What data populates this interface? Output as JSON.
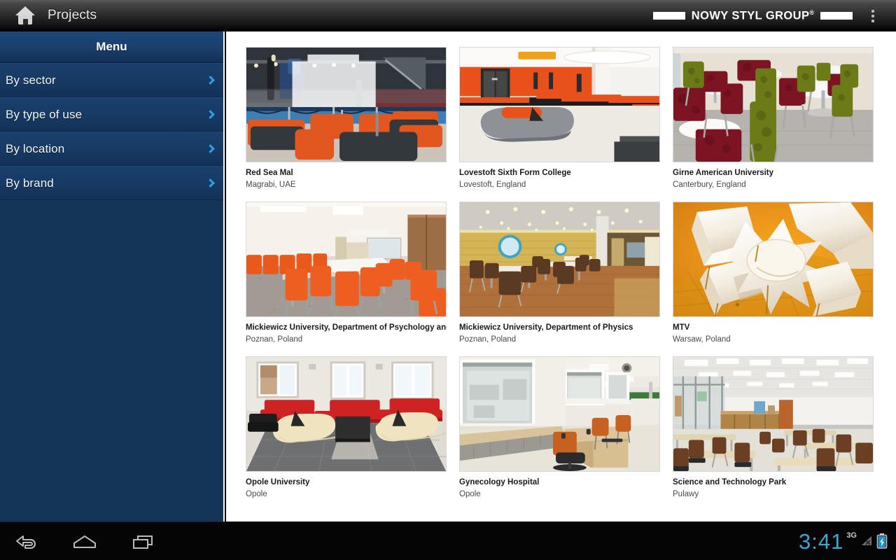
{
  "topbar": {
    "home_icon": "home-icon",
    "title": "Projects",
    "logo_text": "NOWY STYL GROUP",
    "logo_registered": "®",
    "overflow_icon": "overflow-menu-icon"
  },
  "sidebar": {
    "header": "Menu",
    "items": [
      {
        "label": "By sector",
        "icon": "chevron-right-icon"
      },
      {
        "label": "By type of use",
        "icon": "chevron-right-icon"
      },
      {
        "label": "By location",
        "icon": "chevron-right-icon"
      },
      {
        "label": "By brand",
        "icon": "chevron-right-icon"
      }
    ]
  },
  "projects": [
    {
      "title": "Red Sea Mal",
      "location": "Magrabi, UAE",
      "image": "mall-fountain-lounge"
    },
    {
      "title": "Lovestoft Sixth Form College",
      "location": "Lovestoft, England",
      "image": "college-orange-lounge"
    },
    {
      "title": "Girne American University",
      "location": "Canterbury, England",
      "image": "university-cafeteria-chairs"
    },
    {
      "title": "Mickiewicz University, Department of Psychology and",
      "location": "Poznan, Poland",
      "image": "conference-room-orange-chairs"
    },
    {
      "title": "Mickiewicz University, Department of Physics",
      "location": "Poznan, Poland",
      "image": "atrium-wooden-floor"
    },
    {
      "title": "MTV",
      "location": "Warsaw, Poland",
      "image": "mtv-white-sculptural-seating"
    },
    {
      "title": "Opole University",
      "location": "Opole",
      "image": "lobby-red-benches"
    },
    {
      "title": "Gynecology Hospital",
      "location": "Opole",
      "image": "hospital-office-windows"
    },
    {
      "title": "Science and Technology Park",
      "location": "Pulawy",
      "image": "lecture-hall-desks"
    }
  ],
  "navbar": {
    "back_icon": "back-arrow-icon",
    "home_icon": "home-outline-icon",
    "recents_icon": "recent-apps-icon",
    "clock": "3:41",
    "network": "3G",
    "signal_icon": "signal-no-service-icon",
    "battery_icon": "battery-charging-icon"
  },
  "colors": {
    "sidebar_bg": "#143458",
    "menu_item_bg": "#173a64",
    "chevron": "#2f9fe0",
    "clock": "#3aa7d4",
    "topbar_bg": "#2c2c2c",
    "content_bg": "#ffffff"
  }
}
